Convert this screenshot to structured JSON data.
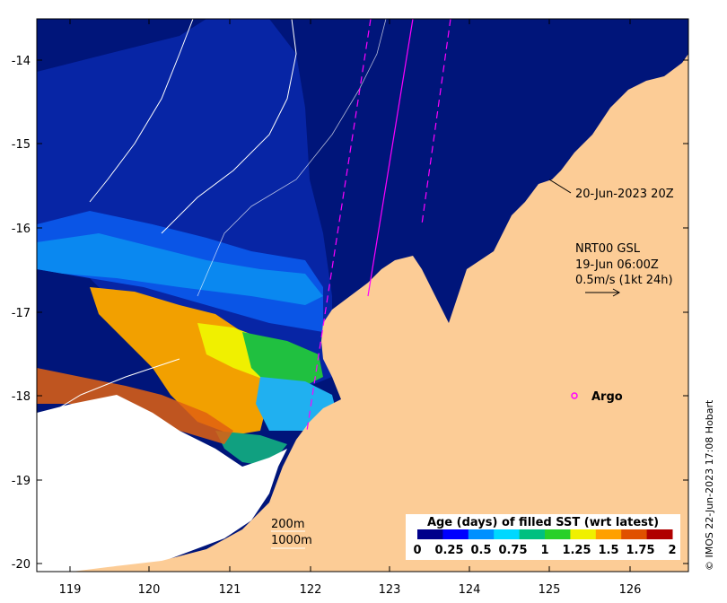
{
  "map": {
    "x_ticks": [
      "119",
      "120",
      "121",
      "122",
      "123",
      "124",
      "125",
      "126"
    ],
    "y_ticks": [
      "-14",
      "-15",
      "-16",
      "-17",
      "-18",
      "-19",
      "-20"
    ],
    "colors": {
      "ocean_deep": "#00157a",
      "land": "#fccc96",
      "cloud_gap": "#ffffff",
      "bathymetry_line": "#ffffff",
      "track_line": "#ff00ff"
    }
  },
  "annotations": {
    "track_time": "20-Jun-2023 20Z",
    "current_source": "NRT00 GSL",
    "current_time": "19-Jun 06:00Z",
    "current_scale": "0.5m/s (1kt 24h)",
    "argo_label": "Argo",
    "depth_200": "200m",
    "depth_1000": "1000m"
  },
  "legend": {
    "title": "Age (days) of filled SST (wrt latest)",
    "ticks": [
      "0",
      "0.25",
      "0.5",
      "0.75",
      "1",
      "1.25",
      "1.5",
      "1.75",
      "2"
    ],
    "colors": [
      "#00008b",
      "#0000ff",
      "#0090ff",
      "#00d8ff",
      "#00c080",
      "#28d028",
      "#f0f000",
      "#ffa000",
      "#e05000",
      "#b00000"
    ]
  },
  "credit": "© IMOS 22-Jun-2023 17:08 Hobart"
}
